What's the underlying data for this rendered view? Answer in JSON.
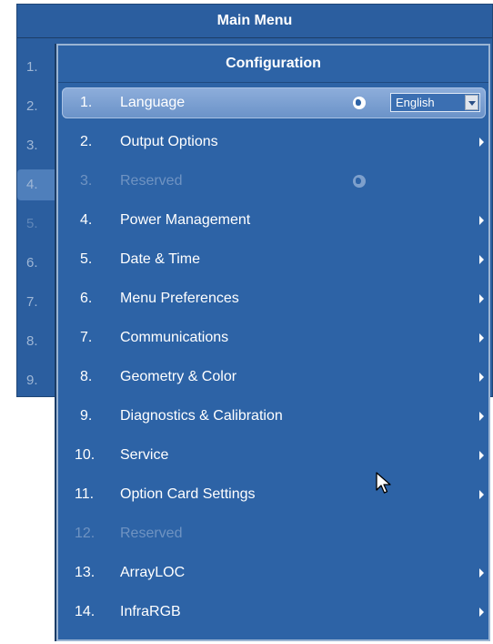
{
  "main_menu": {
    "title": "Main Menu",
    "items": [
      "1.",
      "2.",
      "3.",
      "4.",
      "5.",
      "6.",
      "7.",
      "8.",
      "9."
    ]
  },
  "config": {
    "title": "Configuration",
    "items": [
      {
        "num": "1.",
        "label": "Language",
        "control": "English"
      },
      {
        "num": "2.",
        "label": "Output Options"
      },
      {
        "num": "3.",
        "label": "Reserved"
      },
      {
        "num": "4.",
        "label": "Power Management"
      },
      {
        "num": "5.",
        "label": "Date & Time"
      },
      {
        "num": "6.",
        "label": "Menu Preferences"
      },
      {
        "num": "7.",
        "label": "Communications"
      },
      {
        "num": "8.",
        "label": "Geometry & Color"
      },
      {
        "num": "9.",
        "label": "Diagnostics & Calibration"
      },
      {
        "num": "10.",
        "label": "Service"
      },
      {
        "num": "11.",
        "label": "Option Card Settings"
      },
      {
        "num": "12.",
        "label": "Reserved"
      },
      {
        "num": "13.",
        "label": "ArrayLOC"
      },
      {
        "num": "14.",
        "label": "InfraRGB"
      }
    ]
  },
  "icons": {
    "submenu": "chevron-right-icon",
    "language": "globe-icon",
    "cursor": "mouse-pointer-icon"
  },
  "colors": {
    "panel": "#2d63a6",
    "selected": "#7a9fd2",
    "disabled_text": "#6f93c2"
  }
}
